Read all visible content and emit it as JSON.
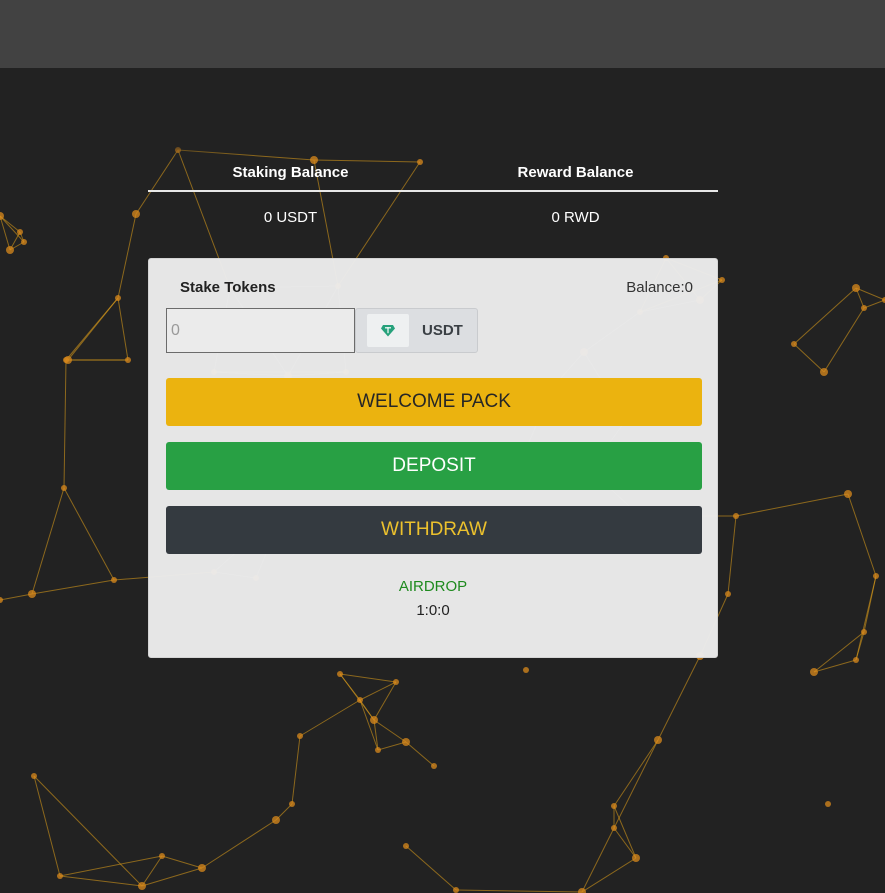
{
  "balances": {
    "staking_label": "Staking Balance",
    "reward_label": "Reward Balance",
    "staking_value": "0 USDT",
    "reward_value": "0 RWD"
  },
  "stake_form": {
    "title": "Stake Tokens",
    "balance_text": "Balance:0",
    "amount_placeholder": "0",
    "token_symbol": "USDT",
    "token_icon": "tether-diamond-icon"
  },
  "buttons": {
    "welcome_pack": "WELCOME PACK",
    "deposit": "DEPOSIT",
    "withdraw": "WITHDRAW"
  },
  "airdrop": {
    "label": "AIRDROP",
    "countdown": "1:0:0"
  },
  "colors": {
    "background": "#222222",
    "topbar": "#424242",
    "network_accent": "#e3a21a",
    "welcome_pack": "#ebb30f",
    "deposit": "#28a044",
    "withdraw_bg": "#343a40",
    "withdraw_text": "#ecc12d",
    "airdrop_link": "#1e8a1e",
    "token_icon": "#26a17b"
  }
}
